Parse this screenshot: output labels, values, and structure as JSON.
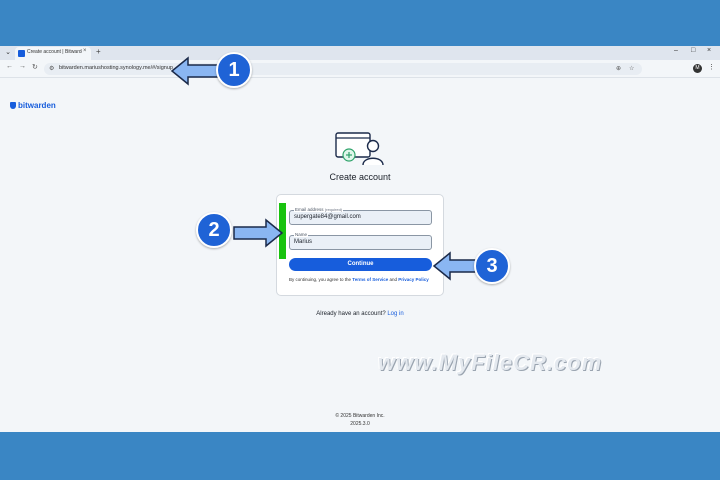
{
  "browser": {
    "tab_title": "Create account | Bitwarden",
    "tab_close": "×",
    "tab_new": "+",
    "tab_menu": "⌄",
    "window_controls": [
      "–",
      "□",
      "×"
    ],
    "nav": {
      "back": "←",
      "forward": "→",
      "reload": "↻"
    },
    "url": "bitwarden.mariushosting.synology.me/#/signup",
    "profile_initial": "M",
    "kebab": "⋮",
    "translate_icon": "⊕",
    "star_icon": "☆"
  },
  "app": {
    "brand": "bitwarden",
    "heading": "Create account",
    "email_field": {
      "label": "Email address",
      "required": "(required)",
      "value": "supergate84@gmail.com"
    },
    "name_field": {
      "label": "Name",
      "value": "Marius"
    },
    "continue_label": "Continue",
    "legal": {
      "prefix": "By continuing, you agree to the ",
      "terms": "Terms of Service",
      "and": " and ",
      "privacy": "Privacy Policy"
    },
    "login_prompt": "Already have an account?",
    "login_link": "Log in",
    "footer_copyright": "© 2025 Bitwarden Inc.",
    "footer_version": "2025.3.0"
  },
  "annotations": {
    "badges": [
      "1",
      "2",
      "3"
    ],
    "arrow_color": "#8ab6f2",
    "badge_color": "#1f63d6",
    "highlight_color": "#19c30f"
  },
  "watermark": "www.MyFileCR.com"
}
